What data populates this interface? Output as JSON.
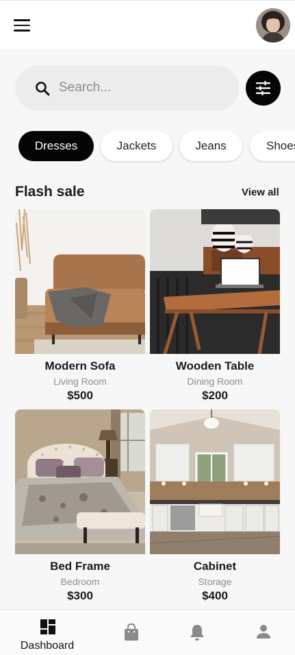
{
  "header": {
    "menu_icon": "hamburger-menu-icon",
    "avatar_icon": "user-avatar"
  },
  "search": {
    "placeholder": "Search...",
    "value": "",
    "icon": "search-icon",
    "filter_icon": "tune-sliders-icon"
  },
  "categories": [
    {
      "label": "Dresses",
      "active": true
    },
    {
      "label": "Jackets",
      "active": false
    },
    {
      "label": "Jeans",
      "active": false
    },
    {
      "label": "Shoes",
      "active": false
    }
  ],
  "flash_sale": {
    "title": "Flash sale",
    "view_all": "View all",
    "products": [
      {
        "name": "Modern Sofa",
        "category": "Living Room",
        "price": "$500"
      },
      {
        "name": "Wooden Table",
        "category": "Dining Room",
        "price": "$200"
      },
      {
        "name": "Bed Frame",
        "category": "Bedroom",
        "price": "$300"
      },
      {
        "name": "Cabinet",
        "category": "Storage",
        "price": "$400"
      }
    ]
  },
  "bottom_nav": {
    "items": [
      {
        "label": "Dashboard",
        "icon": "dashboard-icon",
        "active": true
      },
      {
        "label": "",
        "icon": "shopping-bag-icon",
        "active": false
      },
      {
        "label": "",
        "icon": "bell-icon",
        "active": false
      },
      {
        "label": "",
        "icon": "person-icon",
        "active": false
      }
    ]
  },
  "colors": {
    "background": "#f7f7f7",
    "active_chip": "#050505",
    "muted_text": "#8c8c8c",
    "nav_icon_inactive": "#8a8a8a"
  }
}
